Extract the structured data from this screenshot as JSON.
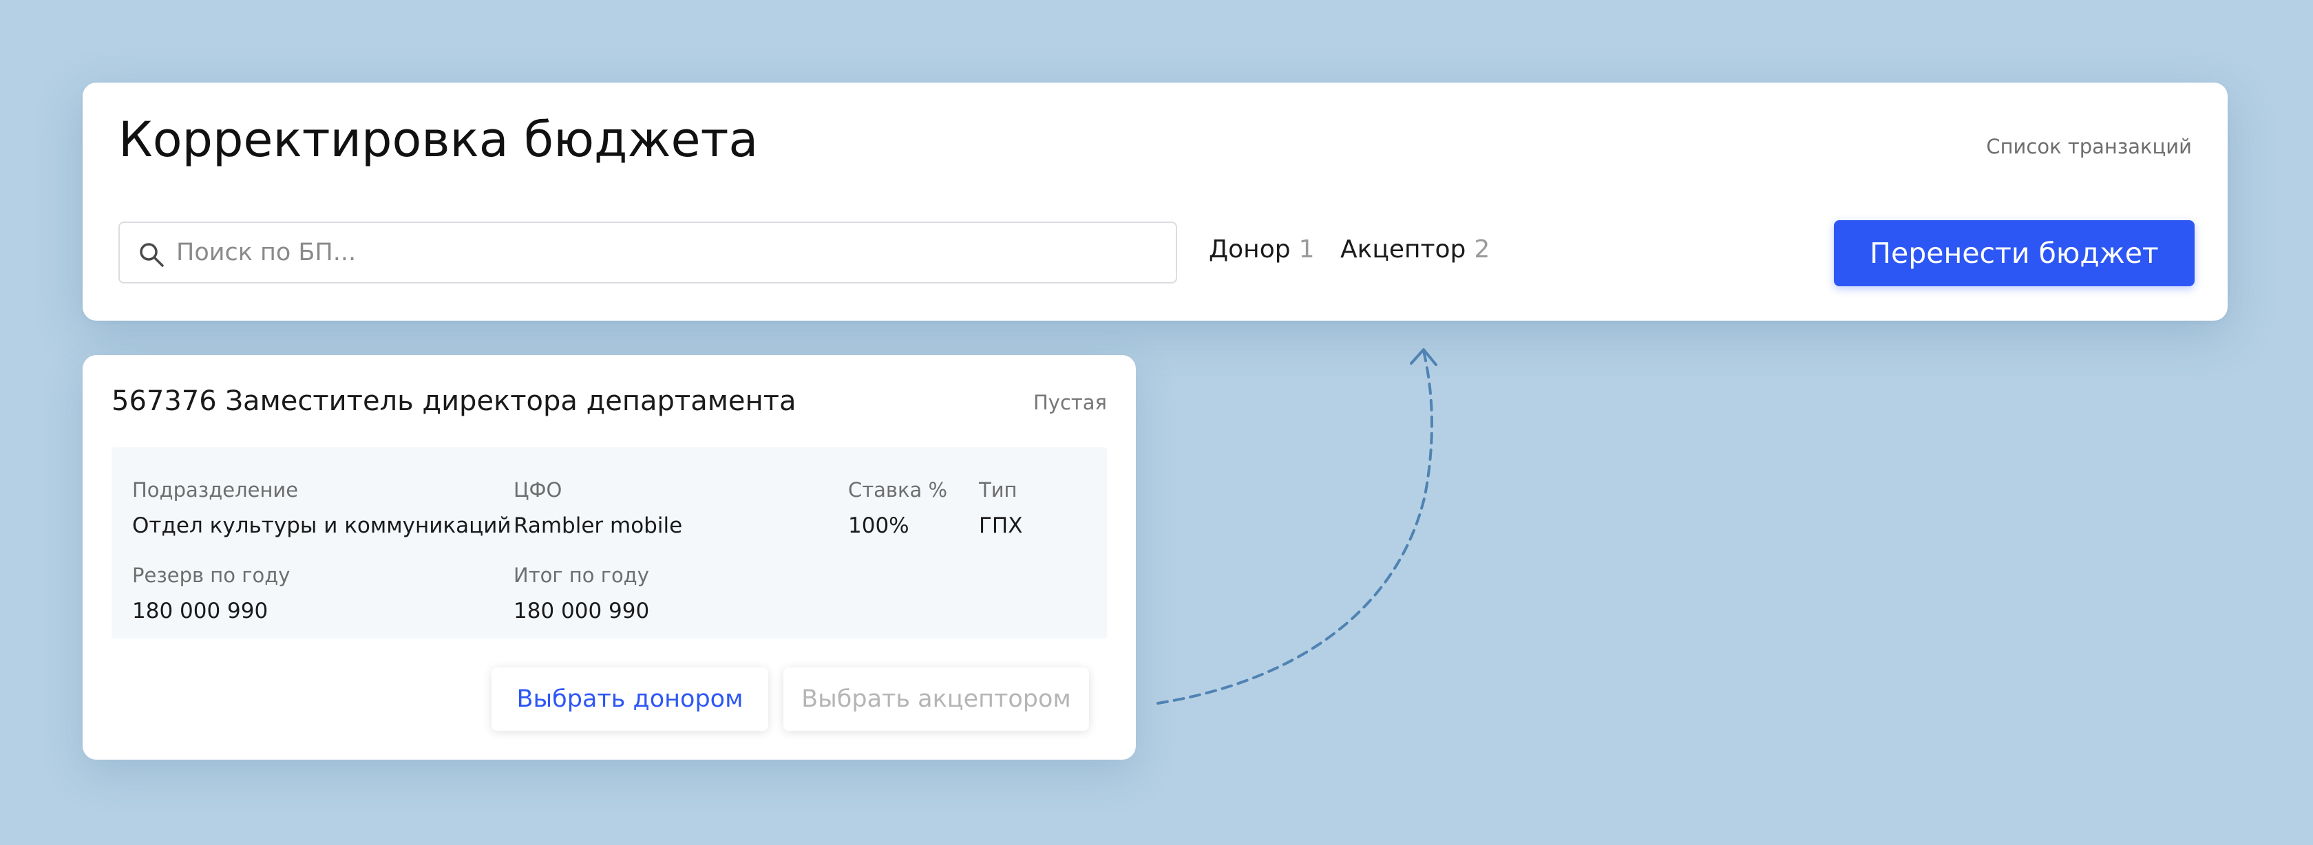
{
  "header": {
    "title": "Корректировка бюджета",
    "transactions_link": "Список транзакций",
    "search": {
      "placeholder": "Поиск по БП...",
      "value": ""
    },
    "filters": [
      {
        "label": "Донор",
        "count": "1"
      },
      {
        "label": "Акцептор",
        "count": "2"
      }
    ],
    "transfer_button": "Перенести бюджет"
  },
  "card": {
    "title": "567376 Заместитель директора департамента",
    "status": "Пустая",
    "fields": {
      "division": {
        "label": "Подразделение",
        "value": "Отдел культуры и коммуникаций"
      },
      "cfo": {
        "label": "ЦФО",
        "value": "Rambler mobile"
      },
      "rate": {
        "label": "Ставка %",
        "value": "100%"
      },
      "type": {
        "label": "Тип",
        "value": "ГПХ"
      },
      "reserve": {
        "label": "Резерв по году",
        "value": "180 000 990"
      },
      "total": {
        "label": "Итог по году",
        "value": "180 000 990"
      }
    },
    "donor_button": "Выбрать  донором",
    "acceptor_button": "Выбрать акцептором"
  },
  "icons": {
    "search": "search-icon",
    "arrow": "dashed-arrow-icon"
  },
  "colors": {
    "background": "#b5d0e4",
    "accent": "#2d57f5",
    "disabled_text": "#b5b5b5",
    "info_panel": "#f4f8fb",
    "arrow": "#4f83b3"
  }
}
